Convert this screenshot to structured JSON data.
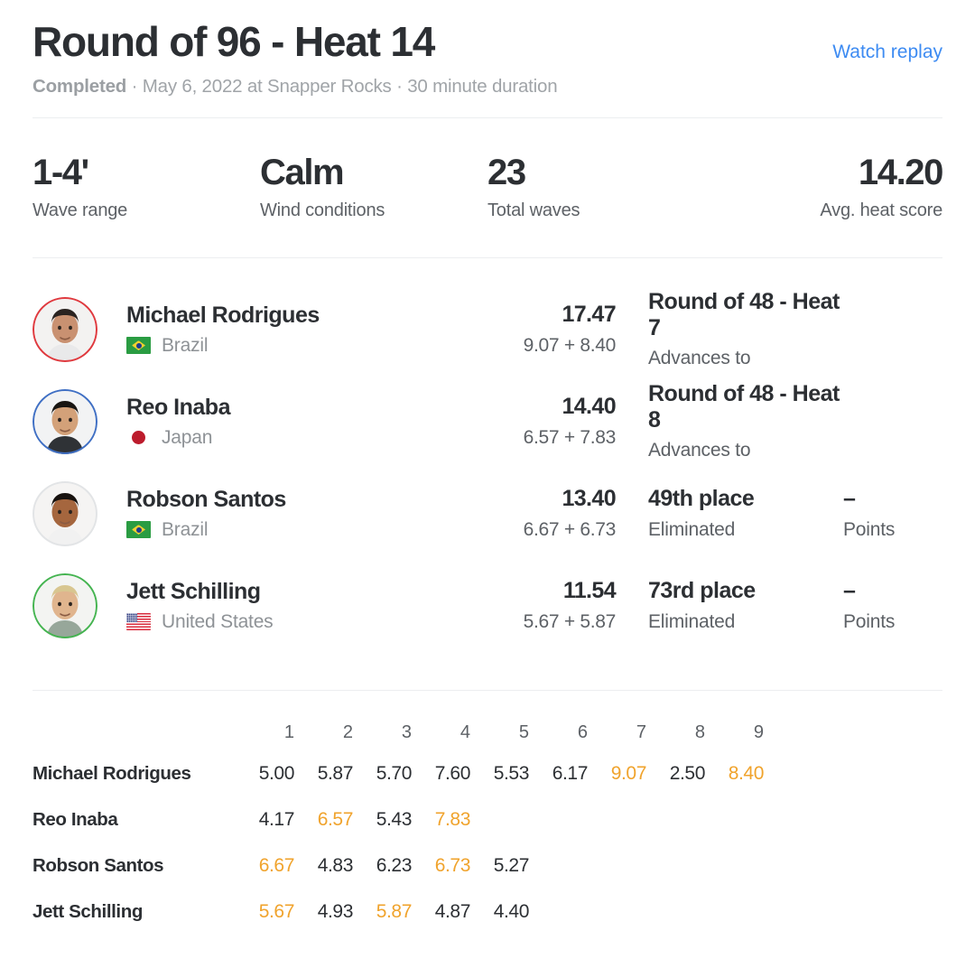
{
  "header": {
    "title": "Round of 96 - Heat 14",
    "watch_replay_label": "Watch replay",
    "status": "Completed",
    "meta": " · May 6, 2022 at Snapper Rocks · 30 minute duration",
    "link_color": "#3d8bf2"
  },
  "stats": [
    {
      "value": "1-4'",
      "label": "Wave range"
    },
    {
      "value": "Calm",
      "label": "Wind conditions"
    },
    {
      "value": "23",
      "label": "Total waves"
    },
    {
      "value": "14.20",
      "label": "Avg. heat score"
    }
  ],
  "athletes": [
    {
      "name": "Michael Rodrigues",
      "country": "Brazil",
      "flag": "brazil-flag",
      "ring_color": "#e0393e",
      "score_total": "17.47",
      "score_breakdown": "9.07 + 8.40",
      "result_title": "Round of 48 - Heat 7",
      "result_sub": "Advances to",
      "points_value": "",
      "points_label": "",
      "has_points": false
    },
    {
      "name": "Reo Inaba",
      "country": "Japan",
      "flag": "japan-flag",
      "ring_color": "#3f6fc4",
      "score_total": "14.40",
      "score_breakdown": "6.57 + 7.83",
      "result_title": "Round of 48 - Heat 8",
      "result_sub": "Advances to",
      "points_value": "",
      "points_label": "",
      "has_points": false
    },
    {
      "name": "Robson Santos",
      "country": "Brazil",
      "flag": "brazil-flag",
      "ring_color": "#e2e4e6",
      "score_total": "13.40",
      "score_breakdown": "6.67 + 6.73",
      "result_title": "49th place",
      "result_sub": "Eliminated",
      "points_value": "–",
      "points_label": "Points",
      "has_points": true
    },
    {
      "name": "Jett Schilling",
      "country": "United States",
      "flag": "usa-flag",
      "ring_color": "#44b450",
      "score_total": "11.54",
      "score_breakdown": "5.67 + 5.87",
      "result_title": "73rd place",
      "result_sub": "Eliminated",
      "points_value": "–",
      "points_label": "Points",
      "has_points": true
    }
  ],
  "wave_table": {
    "counting_color": "#f0a32c",
    "columns": [
      "1",
      "2",
      "3",
      "4",
      "5",
      "6",
      "7",
      "8",
      "9"
    ],
    "rows": [
      {
        "athlete": "Michael Rodrigues",
        "scores": [
          "5.00",
          "5.87",
          "5.70",
          "7.60",
          "5.53",
          "6.17",
          "9.07",
          "2.50",
          "8.40"
        ],
        "counting": [
          false,
          false,
          false,
          false,
          false,
          false,
          true,
          false,
          true
        ]
      },
      {
        "athlete": "Reo Inaba",
        "scores": [
          "4.17",
          "6.57",
          "5.43",
          "7.83",
          "",
          "",
          "",
          "",
          ""
        ],
        "counting": [
          false,
          true,
          false,
          true,
          false,
          false,
          false,
          false,
          false
        ]
      },
      {
        "athlete": "Robson Santos",
        "scores": [
          "6.67",
          "4.83",
          "6.23",
          "6.73",
          "5.27",
          "",
          "",
          "",
          ""
        ],
        "counting": [
          true,
          false,
          false,
          true,
          false,
          false,
          false,
          false,
          false
        ]
      },
      {
        "athlete": "Jett Schilling",
        "scores": [
          "5.67",
          "4.93",
          "5.87",
          "4.87",
          "4.40",
          "",
          "",
          "",
          ""
        ],
        "counting": [
          true,
          false,
          true,
          false,
          false,
          false,
          false,
          false,
          false
        ]
      }
    ]
  }
}
